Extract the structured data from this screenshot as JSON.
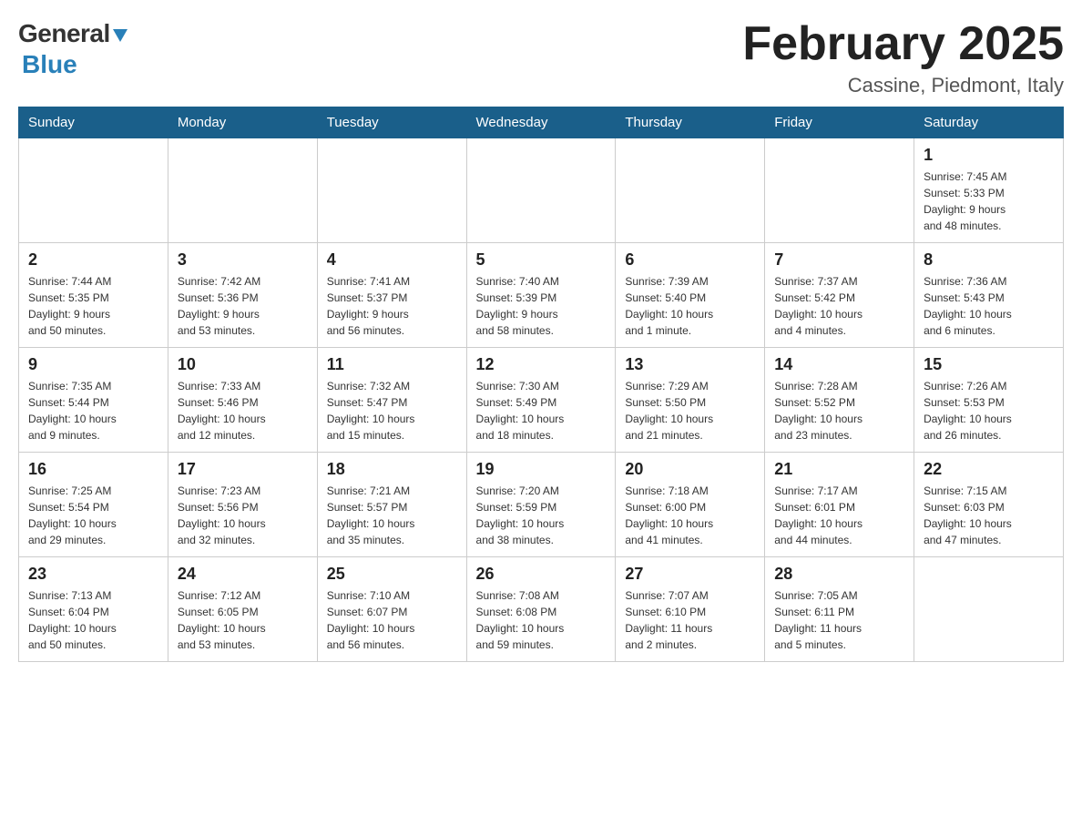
{
  "header": {
    "logo_general": "General",
    "logo_blue": "Blue",
    "month_title": "February 2025",
    "location": "Cassine, Piedmont, Italy"
  },
  "days_of_week": [
    "Sunday",
    "Monday",
    "Tuesday",
    "Wednesday",
    "Thursday",
    "Friday",
    "Saturday"
  ],
  "weeks": [
    [
      {
        "day": "",
        "info": ""
      },
      {
        "day": "",
        "info": ""
      },
      {
        "day": "",
        "info": ""
      },
      {
        "day": "",
        "info": ""
      },
      {
        "day": "",
        "info": ""
      },
      {
        "day": "",
        "info": ""
      },
      {
        "day": "1",
        "info": "Sunrise: 7:45 AM\nSunset: 5:33 PM\nDaylight: 9 hours\nand 48 minutes."
      }
    ],
    [
      {
        "day": "2",
        "info": "Sunrise: 7:44 AM\nSunset: 5:35 PM\nDaylight: 9 hours\nand 50 minutes."
      },
      {
        "day": "3",
        "info": "Sunrise: 7:42 AM\nSunset: 5:36 PM\nDaylight: 9 hours\nand 53 minutes."
      },
      {
        "day": "4",
        "info": "Sunrise: 7:41 AM\nSunset: 5:37 PM\nDaylight: 9 hours\nand 56 minutes."
      },
      {
        "day": "5",
        "info": "Sunrise: 7:40 AM\nSunset: 5:39 PM\nDaylight: 9 hours\nand 58 minutes."
      },
      {
        "day": "6",
        "info": "Sunrise: 7:39 AM\nSunset: 5:40 PM\nDaylight: 10 hours\nand 1 minute."
      },
      {
        "day": "7",
        "info": "Sunrise: 7:37 AM\nSunset: 5:42 PM\nDaylight: 10 hours\nand 4 minutes."
      },
      {
        "day": "8",
        "info": "Sunrise: 7:36 AM\nSunset: 5:43 PM\nDaylight: 10 hours\nand 6 minutes."
      }
    ],
    [
      {
        "day": "9",
        "info": "Sunrise: 7:35 AM\nSunset: 5:44 PM\nDaylight: 10 hours\nand 9 minutes."
      },
      {
        "day": "10",
        "info": "Sunrise: 7:33 AM\nSunset: 5:46 PM\nDaylight: 10 hours\nand 12 minutes."
      },
      {
        "day": "11",
        "info": "Sunrise: 7:32 AM\nSunset: 5:47 PM\nDaylight: 10 hours\nand 15 minutes."
      },
      {
        "day": "12",
        "info": "Sunrise: 7:30 AM\nSunset: 5:49 PM\nDaylight: 10 hours\nand 18 minutes."
      },
      {
        "day": "13",
        "info": "Sunrise: 7:29 AM\nSunset: 5:50 PM\nDaylight: 10 hours\nand 21 minutes."
      },
      {
        "day": "14",
        "info": "Sunrise: 7:28 AM\nSunset: 5:52 PM\nDaylight: 10 hours\nand 23 minutes."
      },
      {
        "day": "15",
        "info": "Sunrise: 7:26 AM\nSunset: 5:53 PM\nDaylight: 10 hours\nand 26 minutes."
      }
    ],
    [
      {
        "day": "16",
        "info": "Sunrise: 7:25 AM\nSunset: 5:54 PM\nDaylight: 10 hours\nand 29 minutes."
      },
      {
        "day": "17",
        "info": "Sunrise: 7:23 AM\nSunset: 5:56 PM\nDaylight: 10 hours\nand 32 minutes."
      },
      {
        "day": "18",
        "info": "Sunrise: 7:21 AM\nSunset: 5:57 PM\nDaylight: 10 hours\nand 35 minutes."
      },
      {
        "day": "19",
        "info": "Sunrise: 7:20 AM\nSunset: 5:59 PM\nDaylight: 10 hours\nand 38 minutes."
      },
      {
        "day": "20",
        "info": "Sunrise: 7:18 AM\nSunset: 6:00 PM\nDaylight: 10 hours\nand 41 minutes."
      },
      {
        "day": "21",
        "info": "Sunrise: 7:17 AM\nSunset: 6:01 PM\nDaylight: 10 hours\nand 44 minutes."
      },
      {
        "day": "22",
        "info": "Sunrise: 7:15 AM\nSunset: 6:03 PM\nDaylight: 10 hours\nand 47 minutes."
      }
    ],
    [
      {
        "day": "23",
        "info": "Sunrise: 7:13 AM\nSunset: 6:04 PM\nDaylight: 10 hours\nand 50 minutes."
      },
      {
        "day": "24",
        "info": "Sunrise: 7:12 AM\nSunset: 6:05 PM\nDaylight: 10 hours\nand 53 minutes."
      },
      {
        "day": "25",
        "info": "Sunrise: 7:10 AM\nSunset: 6:07 PM\nDaylight: 10 hours\nand 56 minutes."
      },
      {
        "day": "26",
        "info": "Sunrise: 7:08 AM\nSunset: 6:08 PM\nDaylight: 10 hours\nand 59 minutes."
      },
      {
        "day": "27",
        "info": "Sunrise: 7:07 AM\nSunset: 6:10 PM\nDaylight: 11 hours\nand 2 minutes."
      },
      {
        "day": "28",
        "info": "Sunrise: 7:05 AM\nSunset: 6:11 PM\nDaylight: 11 hours\nand 5 minutes."
      },
      {
        "day": "",
        "info": ""
      }
    ]
  ]
}
